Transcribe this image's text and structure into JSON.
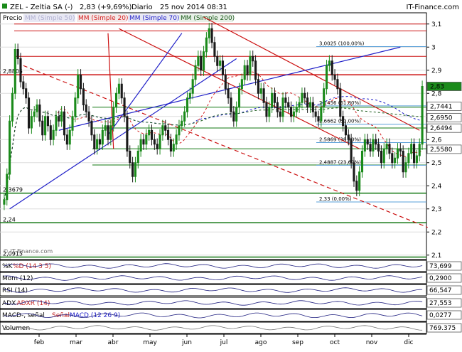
{
  "header": {
    "symbol_line": "ZEL - Zeltia SA (-)",
    "quote": "2,83 (+9,69%)",
    "period": "Diario",
    "date": "25 nov 2014 08:31",
    "brand": "IT-Finance.com"
  },
  "legend": {
    "price": "Precio",
    "mm20": "MM (Simple 20)",
    "mm50": "MM (Simple 50)",
    "mm70": "MM (Simple 70)",
    "mm200": "MM (Simple 200)"
  },
  "colors": {
    "up": "#1a8a1a",
    "down": "#1a1a1a",
    "mm20": "#d42020",
    "mm70": "#2020c8",
    "mm200": "#1a5a1a",
    "support": "#117711",
    "resistance": "#cc1111",
    "channel": "#2020c8",
    "panel_bg": "#ffffff"
  },
  "chart_data": {
    "type": "candlestick",
    "x_months": [
      "feb",
      "mar",
      "abr",
      "may",
      "jun",
      "jul",
      "ago",
      "sep",
      "oct",
      "nov",
      "dic"
    ],
    "y_ticks": [
      "3,1",
      "3",
      "2,9",
      "2,8",
      "2,7",
      "2,6",
      "2,5",
      "2,4",
      "2,3",
      "2,2",
      "2,1"
    ],
    "y_range": [
      2.09,
      3.13
    ],
    "last_price": "2,83",
    "value_tags": [
      {
        "label": "2,83",
        "value": 2.83,
        "color": "#1a8a1a"
      },
      {
        "label": "2,7441",
        "value": 2.7441,
        "color": "#ffffff"
      },
      {
        "label": "2,6950",
        "value": 2.695,
        "color": "#ffffff"
      },
      {
        "label": "2,6494",
        "value": 2.6494,
        "color": "#ffffff"
      },
      {
        "label": "2,5580",
        "value": 2.558,
        "color": "#ffffff"
      }
    ],
    "horizontal_levels": [
      {
        "label": "2,8805",
        "value": 2.8805,
        "color": "#cc1111"
      },
      {
        "label": "2,3679",
        "value": 2.3679,
        "color": "#117711"
      },
      {
        "label": "2,24",
        "value": 2.24,
        "color": "#117711"
      },
      {
        "label": "2,0915",
        "value": 2.0915,
        "color": "#117711"
      }
    ],
    "fibonacci": [
      {
        "label": "3,0025 (100,00%)",
        "value": 3.0025
      },
      {
        "label": "2,7456 (61,80%)",
        "value": 2.7456
      },
      {
        "label": "2,6662 (50,00%)",
        "value": 2.6662
      },
      {
        "label": "2,5869 (38,20%)",
        "value": 2.5869
      },
      {
        "label": "2,4887 (23,60%)",
        "value": 2.4887
      },
      {
        "label": "2,33 (0,00%)",
        "value": 2.33
      }
    ],
    "closes": [
      2.34,
      2.45,
      2.68,
      2.8,
      2.99,
      2.95,
      2.85,
      2.82,
      2.78,
      2.65,
      2.7,
      2.72,
      2.75,
      2.68,
      2.62,
      2.7,
      2.66,
      2.6,
      2.64,
      2.7,
      2.68,
      2.72,
      2.62,
      2.58,
      2.64,
      2.7,
      2.78,
      2.88,
      2.82,
      2.75,
      2.72,
      2.68,
      2.62,
      2.56,
      2.6,
      2.58,
      2.64,
      2.66,
      2.6,
      2.66,
      2.74,
      2.8,
      2.84,
      2.78,
      2.7,
      2.55,
      2.5,
      2.44,
      2.5,
      2.55,
      2.6,
      2.58,
      2.62,
      2.64,
      2.6,
      2.58,
      2.56,
      2.62,
      2.66,
      2.64,
      2.6,
      2.55,
      2.58,
      2.62,
      2.66,
      2.68,
      2.72,
      2.78,
      2.8,
      2.86,
      2.92,
      2.96,
      2.9,
      2.98,
      3.04,
      3.08,
      3.02,
      2.96,
      2.92,
      2.94,
      2.88,
      2.82,
      2.78,
      2.72,
      2.68,
      2.74,
      2.82,
      2.86,
      2.92,
      2.88,
      2.96,
      2.94,
      2.86,
      2.8,
      2.82,
      2.76,
      2.7,
      2.74,
      2.8,
      2.76,
      2.72,
      2.7,
      2.78,
      2.76,
      2.74,
      2.7,
      2.72,
      2.74,
      2.76,
      2.8,
      2.78,
      2.74,
      2.76,
      2.72,
      2.7,
      2.68,
      2.74,
      2.82,
      2.92,
      2.94,
      2.88,
      2.86,
      2.82,
      2.7,
      2.66,
      2.62,
      2.6,
      2.5,
      2.42,
      2.38,
      2.46,
      2.55,
      2.6,
      2.58,
      2.55,
      2.6,
      2.58,
      2.55,
      2.5,
      2.56,
      2.58,
      2.54,
      2.5,
      2.52,
      2.56,
      2.55,
      2.46,
      2.5,
      2.54,
      2.58,
      2.5,
      2.53,
      2.58,
      2.83
    ]
  },
  "indicators": [
    {
      "id": "stoch",
      "label_a": "%K",
      "label_b": "%D (14 3 5)",
      "value": "73,699"
    },
    {
      "id": "mom",
      "label_a": "Mom (12)",
      "label_b": "",
      "value": "0,2900"
    },
    {
      "id": "rsi",
      "label_a": "RSI (14)",
      "label_b": "",
      "value": "66,547"
    },
    {
      "id": "adx",
      "label_a": "ADX",
      "label_b": "ADXR (14)",
      "value": "27,553"
    },
    {
      "id": "macd",
      "label_a": "MACD-, señal",
      "label_b": "Señal",
      "label_c": "MACD (12 26 9)",
      "value": "0,0277"
    },
    {
      "id": "vol",
      "label_a": "Volumen",
      "label_b": "",
      "value": "769.375"
    }
  ],
  "watermark": "© IT-Finance.com"
}
